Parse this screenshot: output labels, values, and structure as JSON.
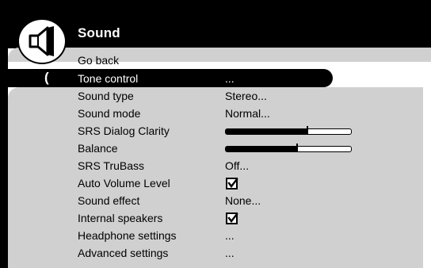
{
  "menu": {
    "title": "Sound",
    "icon": "speaker-icon",
    "colors": {
      "header": "#000000",
      "panel": "#d0d0d0",
      "text": "#000000",
      "selected_text": "#ffffff"
    },
    "selected_index": 1,
    "items": [
      {
        "label": "Go back",
        "value": "",
        "kind": "text"
      },
      {
        "label": "Tone control",
        "value": "...",
        "kind": "text"
      },
      {
        "label": "Sound type",
        "value": "Stereo...",
        "kind": "text"
      },
      {
        "label": "Sound mode",
        "value": "Normal...",
        "kind": "text"
      },
      {
        "label": "SRS Dialog Clarity",
        "value": "",
        "kind": "slider",
        "level": 0.65
      },
      {
        "label": "Balance",
        "value": "",
        "kind": "slider",
        "level": 0.57
      },
      {
        "label": "SRS TruBass",
        "value": "Off...",
        "kind": "text"
      },
      {
        "label": "Auto Volume Level",
        "value": "",
        "kind": "checkbox",
        "checked": true
      },
      {
        "label": "Sound effect",
        "value": "None...",
        "kind": "text"
      },
      {
        "label": "Internal speakers",
        "value": "",
        "kind": "checkbox",
        "checked": true
      },
      {
        "label": "Headphone settings",
        "value": "...",
        "kind": "text"
      },
      {
        "label": "Advanced settings",
        "value": "...",
        "kind": "text"
      }
    ],
    "selection_cap": "("
  }
}
